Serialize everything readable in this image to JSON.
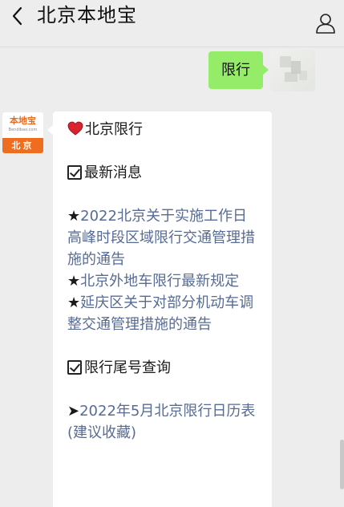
{
  "header": {
    "title": "北京本地宝",
    "back_icon": "chevron-left-icon",
    "profile_icon": "person-icon"
  },
  "chat": {
    "outgoing": {
      "text": "限行",
      "bubble_color": "#95ec69"
    },
    "incoming": {
      "sender_logo": {
        "brand": "本地宝",
        "domain": "Bendibao.com",
        "city": "北京"
      },
      "heading": "北京限行",
      "heading_icon": "heart-icon",
      "sections": [
        {
          "title": "最新消息",
          "items": [
            {
              "bullet": "★",
              "text": "2022北京关于实施工作日高峰时段区域限行交通管理措施的通告"
            },
            {
              "bullet": "★",
              "text": "北京外地车限行最新规定"
            },
            {
              "bullet": "★",
              "text": "延庆区关于对部分机动车调整交通管理措施的通告"
            }
          ]
        },
        {
          "title": "限行尾号查询",
          "items": [
            {
              "bullet": "➤",
              "text": "2022年5月北京限行日历表(建议收藏)"
            }
          ]
        }
      ]
    }
  },
  "colors": {
    "background": "#ededed",
    "link": "#576b95",
    "brand_orange": "#ef6d1e"
  }
}
